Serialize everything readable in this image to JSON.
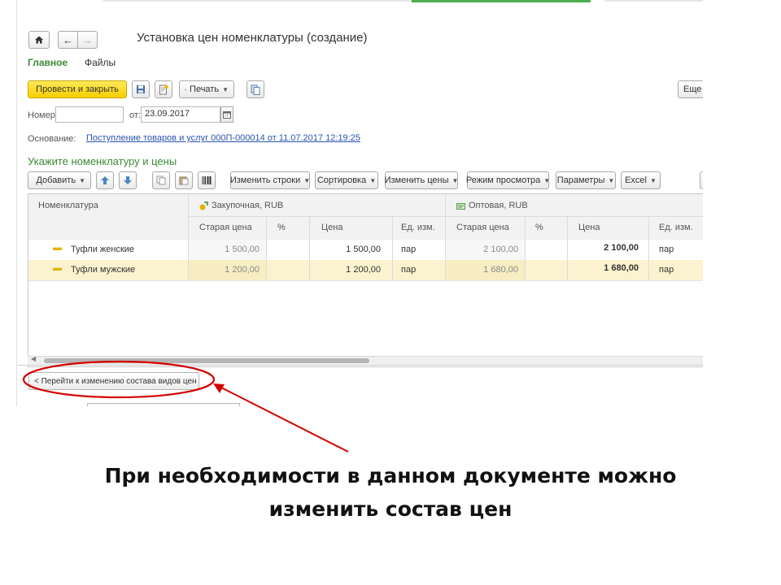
{
  "window": {
    "title": "Установка цен номенклатуры (создание)",
    "tabs": [
      {
        "label": "Главное"
      },
      {
        "label": "Файлы"
      }
    ]
  },
  "toolbar": {
    "post_close_label": "Провести и закрыть",
    "print_label": "Печать",
    "more_label": "Еще"
  },
  "form": {
    "number_label": "Номер:",
    "number_value": "",
    "date_label": "от:",
    "date_value": "23.09.2017",
    "basis_label": "Основание:",
    "basis_link": "Поступление товаров и услуг 000П-000014 от 11.07.2017 12:19:25"
  },
  "section": {
    "title": "Укажите номенклатуру и цены"
  },
  "table_toolbar": {
    "add_label": "Добавить",
    "change_rows_label": "Изменить строки",
    "sort_label": "Сортировка",
    "change_prices_label": "Изменить цены",
    "view_mode_label": "Режим просмотра",
    "params_label": "Параметры",
    "excel_label": "Excel"
  },
  "table": {
    "col_item": "Номенклатура",
    "group1": "Закупочная, RUB",
    "group2": "Оптовая, RUB",
    "sub": {
      "old_price": "Старая цена",
      "percent": "%",
      "price": "Цена",
      "unit": "Ед. изм."
    },
    "rows": [
      {
        "name": "Туфли женские",
        "p_old": "1 500,00",
        "p_pct": "",
        "p_price": "1 500,00",
        "p_unit": "пар",
        "w_old": "2 100,00",
        "w_pct": "",
        "w_price": "2 100,00",
        "w_unit": "пар"
      },
      {
        "name": "Туфли мужские",
        "p_old": "1 200,00",
        "p_pct": "",
        "p_price": "1 200,00",
        "p_unit": "пар",
        "w_old": "1 680,00",
        "w_pct": "",
        "w_price": "1 680,00",
        "w_unit": "пар"
      }
    ]
  },
  "bottom": {
    "goto_label": "< Перейти к изменению состава видов цен"
  },
  "caption": {
    "line1": "При необходимости в данном документе можно",
    "line2": "изменить  состав цен"
  },
  "colors": {
    "accent_green": "#3a8a35",
    "primary_yellow": "#f5cf00",
    "highlight_row": "#fbf3cf",
    "annotation_red": "#d40000",
    "link_blue": "#2a55b0"
  }
}
